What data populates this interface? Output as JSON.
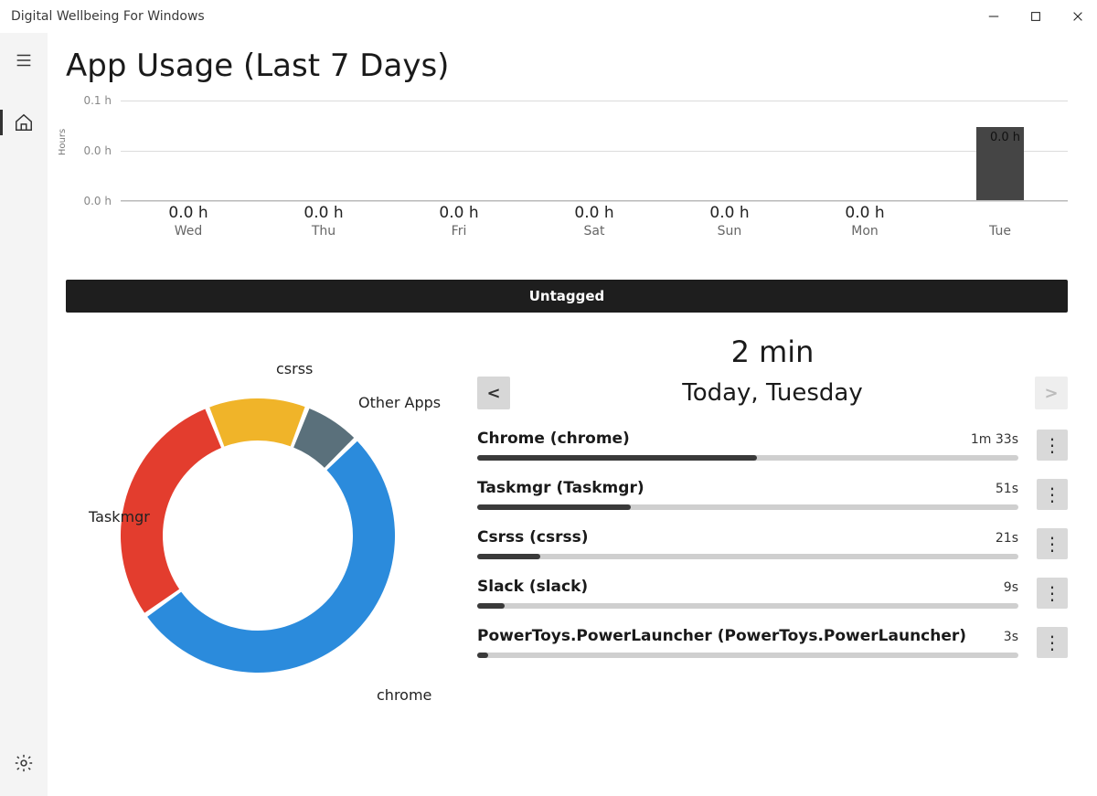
{
  "window": {
    "title": "Digital Wellbeing For Windows"
  },
  "sidebar": {
    "hamburger_label": "Menu",
    "home_label": "Home",
    "settings_label": "Settings"
  },
  "page_title": "App Usage (Last 7 Days)",
  "chart_data": {
    "type": "bar",
    "title": "",
    "ylabel": "Hours",
    "ylim": [
      0,
      0.1
    ],
    "yticks_labels": [
      "0.0 h",
      "0.0 h",
      "0.1 h"
    ],
    "categories": [
      "Wed",
      "Thu",
      "Fri",
      "Sat",
      "Sun",
      "Mon",
      "Tue"
    ],
    "values_hours": [
      0.0,
      0.0,
      0.0,
      0.0,
      0.0,
      0.0,
      0.03
    ],
    "value_labels": [
      "0.0 h",
      "0.0 h",
      "0.0 h",
      "0.0 h",
      "0.0 h",
      "0.0 h",
      "0.0 h"
    ],
    "category_missing_label_index": 6
  },
  "tagbar_label": "Untagged",
  "donut": {
    "type": "donut",
    "slices": [
      {
        "label": "chrome",
        "value": 93,
        "color": "#2b8bdc"
      },
      {
        "label": "Taskmgr",
        "value": 51,
        "color": "#e33d2e"
      },
      {
        "label": "csrss",
        "value": 21,
        "color": "#f0b429"
      },
      {
        "label": "Other Apps",
        "value": 12,
        "color": "#5a707b"
      }
    ],
    "labels": {
      "chrome": "chrome",
      "taskmgr": "Taskmgr",
      "csrss": "csrss",
      "other": "Other Apps"
    }
  },
  "detail": {
    "total_label": "2 min",
    "prev_label": "<",
    "next_label": ">",
    "day_label": "Today, Tuesday",
    "max_seconds": 180,
    "apps": [
      {
        "name": "Chrome (chrome)",
        "time_label": "1m 33s",
        "seconds": 93
      },
      {
        "name": "Taskmgr (Taskmgr)",
        "time_label": "51s",
        "seconds": 51
      },
      {
        "name": "Csrss (csrss)",
        "time_label": "21s",
        "seconds": 21
      },
      {
        "name": "Slack (slack)",
        "time_label": "9s",
        "seconds": 9
      },
      {
        "name": "PowerToys.PowerLauncher (PowerToys.PowerLauncher)",
        "time_label": "3s",
        "seconds": 3
      }
    ]
  }
}
